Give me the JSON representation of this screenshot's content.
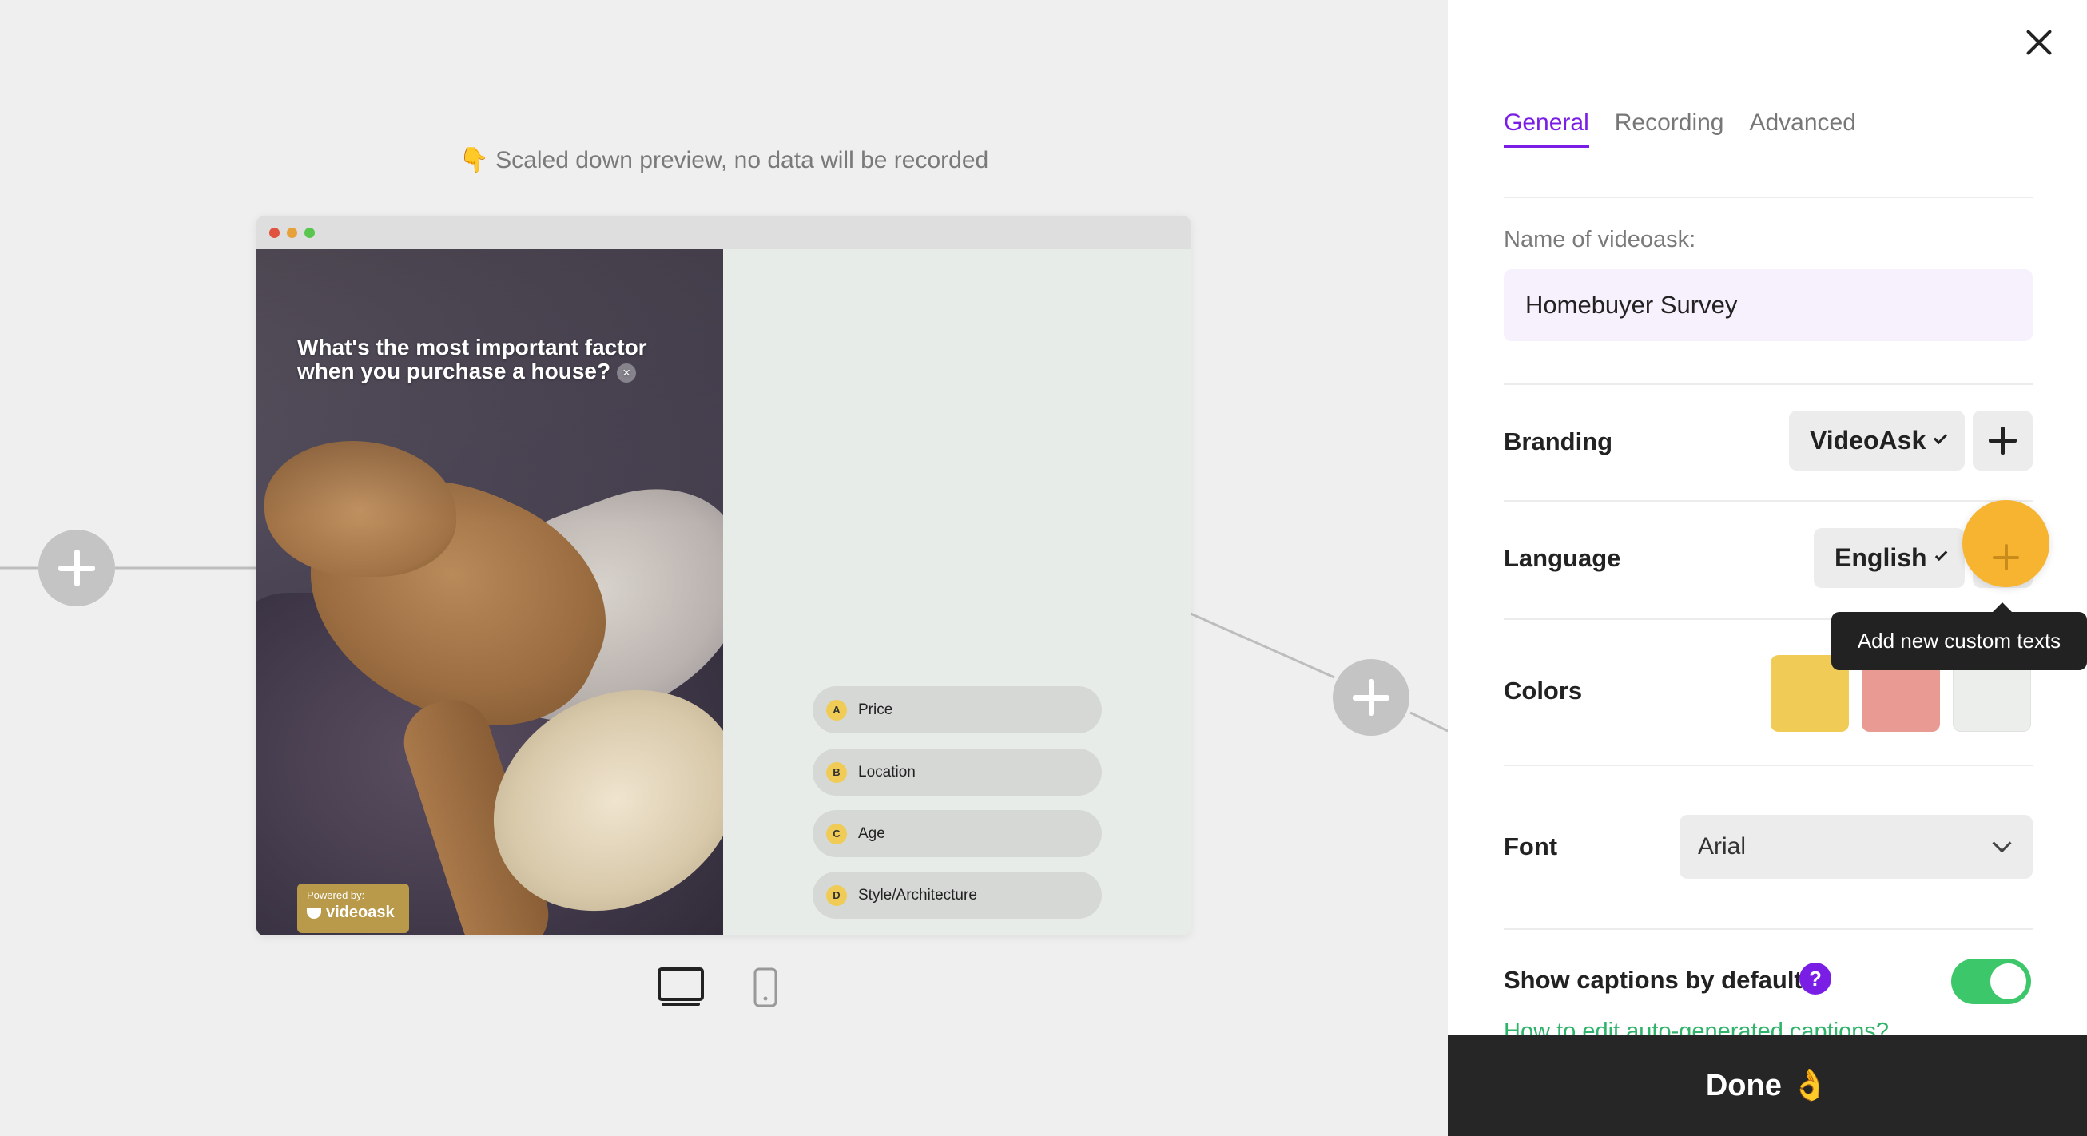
{
  "preview": {
    "note_icon": "👇",
    "note": "Scaled down preview, no data will be recorded"
  },
  "video": {
    "question": "What's the most important factor when you purchase a house?",
    "question_close": "×",
    "powered_by": "Powered by:",
    "brand": "videoask"
  },
  "answers": [
    {
      "letter": "A",
      "label": "Price"
    },
    {
      "letter": "B",
      "label": "Location"
    },
    {
      "letter": "C",
      "label": "Age"
    },
    {
      "letter": "D",
      "label": "Style/Architecture"
    }
  ],
  "panel": {
    "tabs": [
      "General",
      "Recording",
      "Advanced"
    ],
    "name_label": "Name of videoask:",
    "name_value": "Homebuyer Survey",
    "branding_label": "Branding",
    "branding_value": "VideoAsk",
    "language_label": "Language",
    "language_value": "English",
    "tooltip": "Add new custom texts",
    "colors_label": "Colors",
    "colors": [
      "#f0cb55",
      "#e99a92",
      "#eceeec"
    ],
    "font_label": "Font",
    "font_value": "Arial",
    "captions_label": "Show captions by default",
    "captions_help": "?",
    "captions_enabled": true,
    "captions_link": "How to edit auto-generated captions?",
    "done_label": "Done",
    "done_emoji": "👌"
  },
  "colors": {
    "accent": "#7a1ee6",
    "toggle_on": "#3cc76a",
    "highlight": "#f7b431"
  }
}
